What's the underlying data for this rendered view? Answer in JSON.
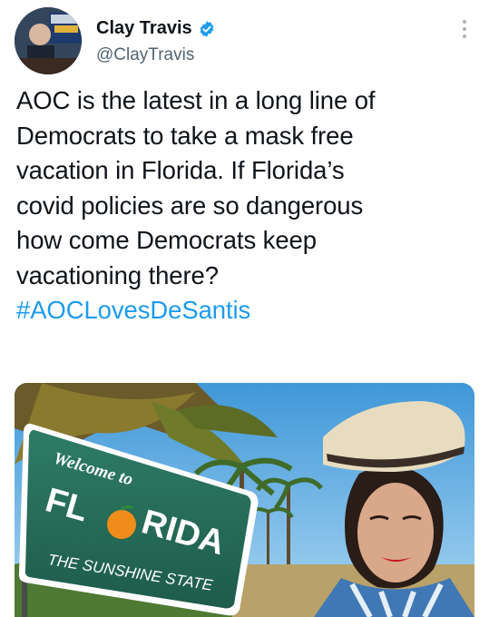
{
  "author": {
    "display_name": "Clay Travis",
    "handle": "@ClayTravis",
    "avatar_icon": "avatar-photo",
    "verified_icon": "verified-badge-icon",
    "verified_color": "#1d9bf0"
  },
  "tweet": {
    "lines": [
      "AOC is the latest in a long line of",
      "Democrats to take a mask free",
      "vacation in Florida. If Florida’s",
      "covid policies are so dangerous",
      "how come Democrats keep",
      "vacationing there?"
    ],
    "hashtag": "#AOCLovesDeSantis",
    "hashtag_color": "#1d9bf0"
  },
  "media": {
    "sign_welcome": "Welcome to",
    "sign_florida_1": "FL",
    "sign_florida_2": "RIDA",
    "sign_sunshine": "THE SUNSHINE STATE"
  },
  "menu": {
    "more_icon": "more-vertical-icon"
  }
}
